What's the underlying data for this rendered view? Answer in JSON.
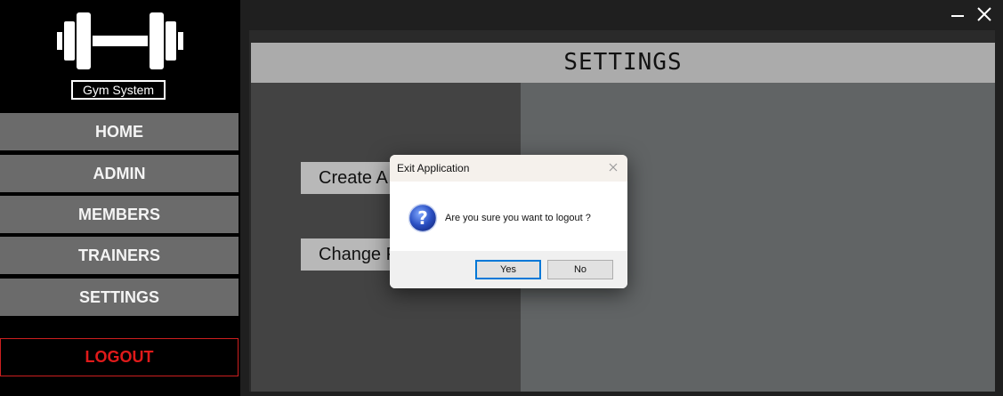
{
  "app": {
    "name": "Gym System"
  },
  "nav": {
    "items": [
      {
        "label": "HOME"
      },
      {
        "label": "ADMIN"
      },
      {
        "label": "MEMBERS"
      },
      {
        "label": "TRAINERS"
      },
      {
        "label": "SETTINGS"
      }
    ],
    "logout_label": "LOGOUT"
  },
  "window": {
    "minimize_icon": "minimize-icon",
    "close_icon": "close-icon"
  },
  "settings": {
    "title": "SETTINGS",
    "buttons": [
      {
        "label": "Create A"
      },
      {
        "label": "Change P"
      }
    ]
  },
  "dialog": {
    "title": "Exit Application",
    "message": "Are you sure you want to logout ?",
    "icon": "question-icon",
    "yes_label": "Yes",
    "no_label": "No"
  },
  "colors": {
    "sidebar_bg": "#000000",
    "nav_button_bg": "#6b6b6b",
    "logout_red": "#e01a1a",
    "header_bg": "#ababab",
    "left_pane_bg": "#434343",
    "right_pane_bg": "#616465",
    "accent_blue": "#0078d7"
  }
}
